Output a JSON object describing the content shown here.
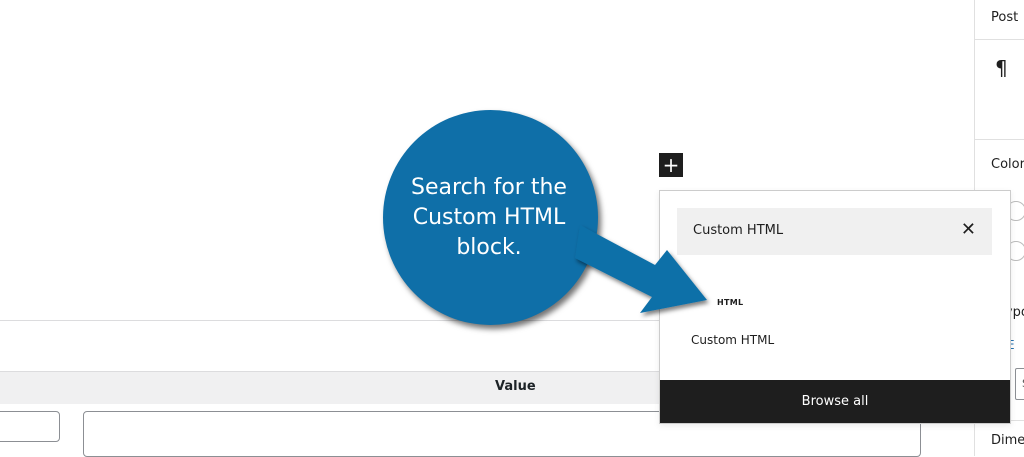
{
  "sidebar": {
    "tab_post": "Post",
    "pilcrow": "¶",
    "color_label": "Color",
    "typography_label": "Typog",
    "typography_link": "E",
    "size_field": "S",
    "dimensions_label": "Dimen"
  },
  "meta": {
    "value_header": "Value"
  },
  "inserter": {
    "add_symbol": "+",
    "search_value": "Custom HTML",
    "clear_symbol": "✕",
    "result_icon_text": "HTML",
    "result_label": "Custom HTML",
    "browse_all": "Browse all"
  },
  "callout": {
    "line1": "Search for the",
    "line2": "Custom HTML",
    "line3": "block.",
    "color": "#0f6fa8"
  }
}
